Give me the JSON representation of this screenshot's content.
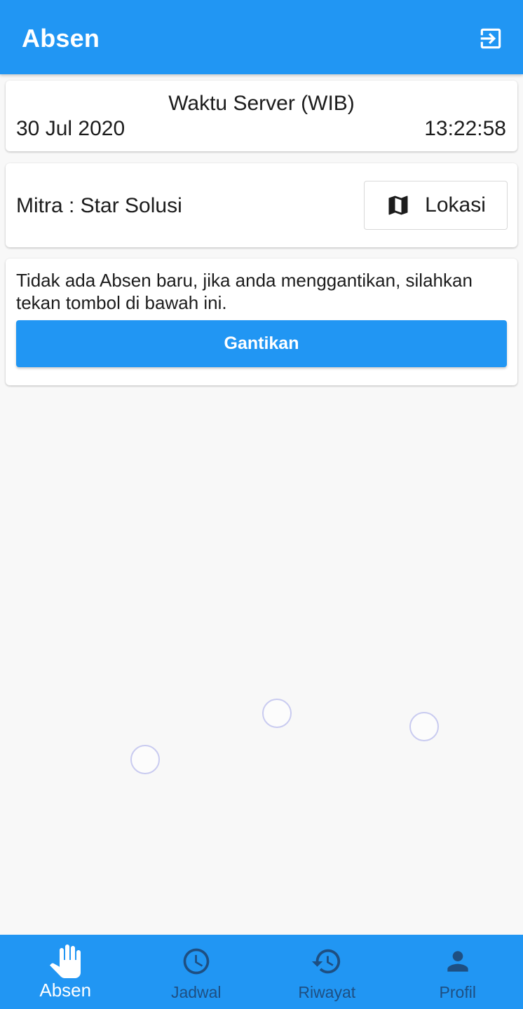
{
  "appbar": {
    "title": "Absen",
    "logout_icon": "logout-icon"
  },
  "server_time": {
    "label": "Waktu Server (WIB)",
    "date": "30 Jul 2020",
    "time": "13:22:58"
  },
  "mitra": {
    "text": "Mitra : Star Solusi",
    "lokasi_label": "Lokasi",
    "lokasi_icon": "map-icon"
  },
  "absen": {
    "message": "Tidak ada Absen baru, jika anda menggantikan, silahkan tekan tombol di bawah ini.",
    "button_label": "Gantikan"
  },
  "nav": {
    "items": [
      {
        "label": "Absen",
        "icon": "hand-icon",
        "active": true
      },
      {
        "label": "Jadwal",
        "icon": "clock-icon",
        "active": false
      },
      {
        "label": "Riwayat",
        "icon": "history-icon",
        "active": false
      },
      {
        "label": "Profil",
        "icon": "person-icon",
        "active": false
      }
    ]
  },
  "colors": {
    "primary": "#2196f3",
    "nav_inactive": "#1e4f82",
    "background": "#f8f8f8"
  }
}
